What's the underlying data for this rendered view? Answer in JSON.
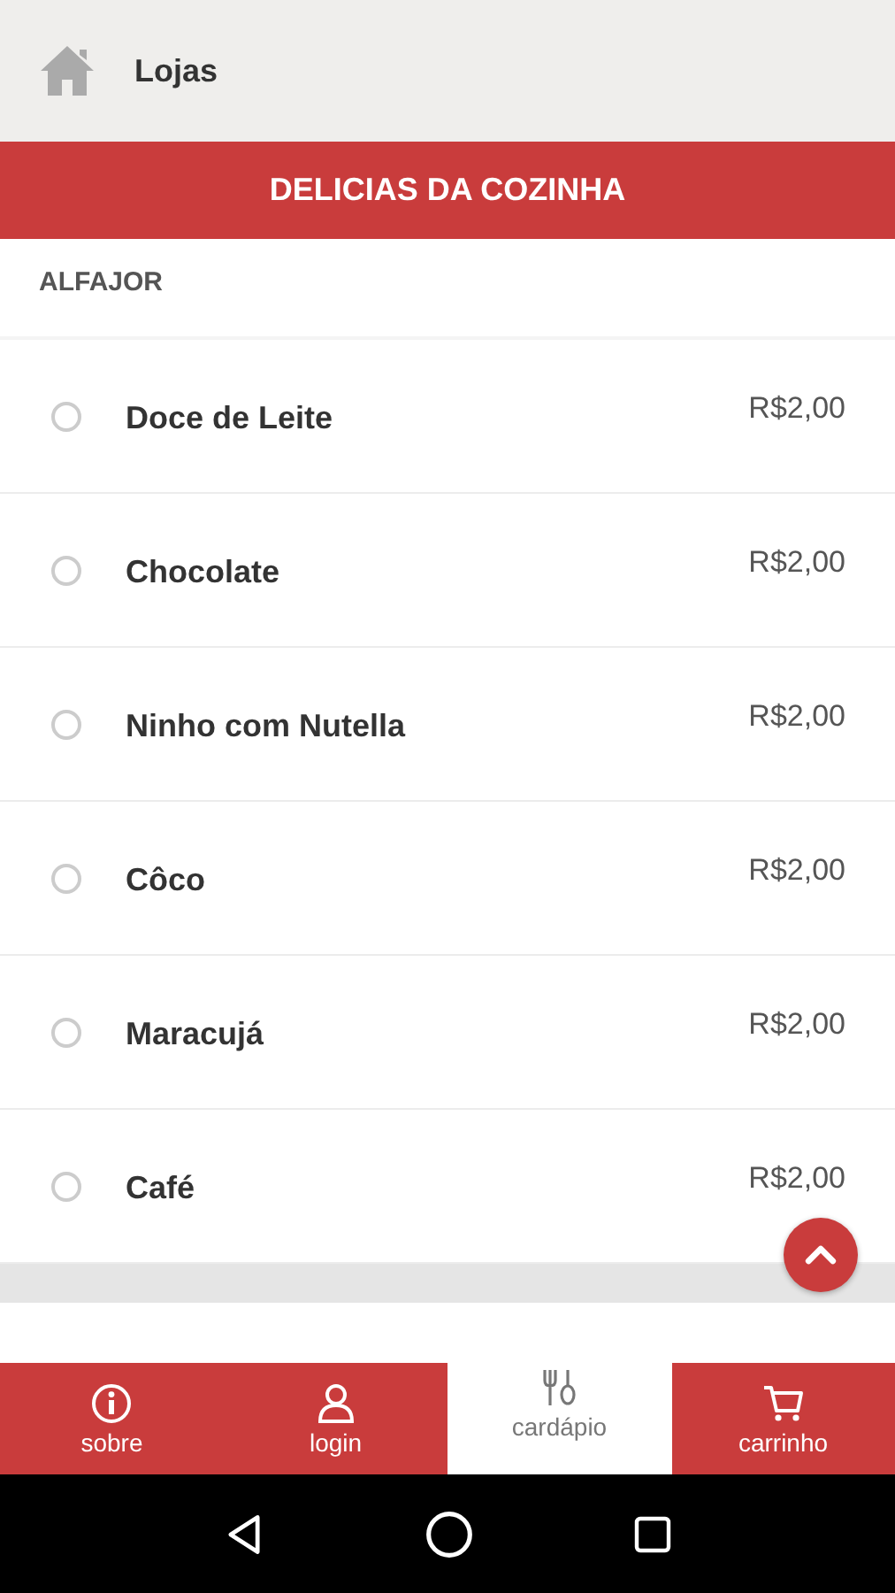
{
  "header": {
    "title": "Lojas"
  },
  "banner": {
    "title": "DELICIAS DA COZINHA"
  },
  "sections": [
    {
      "title": "ALFAJOR",
      "items": [
        {
          "name": "Doce de Leite",
          "price": "R$2,00",
          "selected": false
        },
        {
          "name": "Chocolate",
          "price": "R$2,00",
          "selected": false
        },
        {
          "name": "Ninho com Nutella",
          "price": "R$2,00",
          "selected": false
        },
        {
          "name": "Côco",
          "price": "R$2,00",
          "selected": false
        },
        {
          "name": "Maracujá",
          "price": "R$2,00",
          "selected": false
        },
        {
          "name": "Café",
          "price": "R$2,00",
          "selected": false
        }
      ]
    }
  ],
  "bottom_nav": [
    {
      "label": "sobre",
      "kind": "info",
      "selected": false
    },
    {
      "label": "login",
      "kind": "user",
      "selected": false
    },
    {
      "label": "cardápio",
      "kind": "cutlery",
      "selected": true
    },
    {
      "label": "carrinho",
      "kind": "cart",
      "selected": false
    }
  ]
}
